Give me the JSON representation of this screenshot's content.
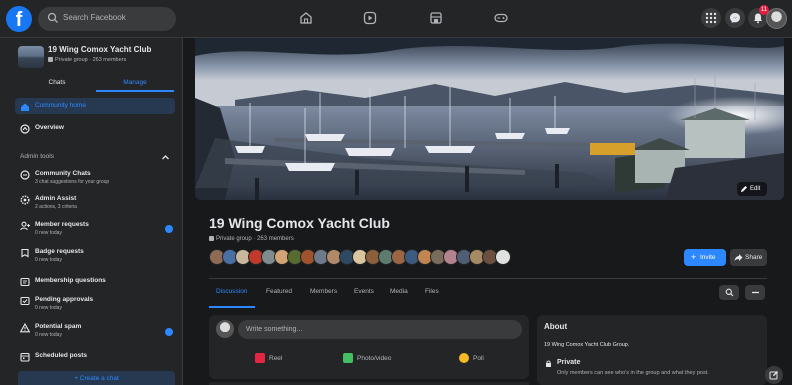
{
  "topbar": {
    "logo": "f",
    "search_placeholder": "Search Facebook",
    "nav_icons": [
      "home-icon",
      "video-icon",
      "marketplace-icon",
      "gaming-icon"
    ],
    "right_icons": [
      "menu-grid-icon",
      "messenger-icon",
      "notifications-icon"
    ],
    "notification_count": "11"
  },
  "sidebar": {
    "group_name": "19 Wing Comox Yacht Club",
    "group_sub": "Private group · 263 members",
    "tabs": {
      "chats": "Chats",
      "manage": "Manage"
    },
    "community_home": "Community home",
    "overview": "Overview",
    "admin_tools_label": "Admin tools",
    "items": [
      {
        "title": "Community Chats",
        "sub": "3 chat suggestions for your group"
      },
      {
        "title": "Admin Assist",
        "sub": "2 actions, 3 criteria"
      },
      {
        "title": "Member requests",
        "sub": "0 new today"
      },
      {
        "title": "Badge requests",
        "sub": "0 new today"
      },
      {
        "title": "Membership questions",
        "sub": ""
      },
      {
        "title": "Pending approvals",
        "sub": "0 new today"
      },
      {
        "title": "Potential spam",
        "sub": "0 new today"
      },
      {
        "title": "Scheduled posts",
        "sub": ""
      }
    ],
    "create_chat": "+ Create a chat"
  },
  "group": {
    "title": "19 Wing Comox Yacht Club",
    "meta": "Private group · 263 members",
    "edit_label": "Edit",
    "invite_label": "Invite",
    "share_label": "Share"
  },
  "tabs": [
    "Discussion",
    "Featured",
    "Members",
    "Events",
    "Media",
    "Files"
  ],
  "composer": {
    "placeholder": "Write something...",
    "actions": [
      "Reel",
      "Photo/video",
      "Poll"
    ]
  },
  "about": {
    "title": "About",
    "description": "19 Wing Comox Yacht Club Group.",
    "privacy_title": "Private",
    "privacy_sub": "Only members can see who's in the group and what they post."
  },
  "colors": {
    "accent": "#2d88ff",
    "background": "#18191a",
    "surface": "#242526"
  }
}
